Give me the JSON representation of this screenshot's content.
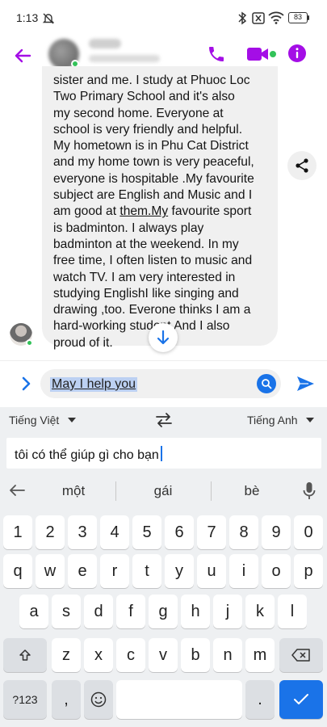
{
  "status_bar": {
    "time": "1:13",
    "battery": "83",
    "icons": [
      "mute-icon",
      "bluetooth-icon",
      "sim-icon",
      "wifi-icon",
      "battery-icon"
    ]
  },
  "header": {
    "back_icon": "back-arrow-icon",
    "actions": [
      "phone-icon",
      "video-icon",
      "info-icon"
    ]
  },
  "conversation": {
    "message_lines": [
      "sister and me. I study at Phuoc Loc",
      "Two Primary School and it's also",
      "my second home. Everyone at",
      "school is very friendly and helpful.",
      "My hometown is in Phu Cat District",
      "and my home town is very peaceful,",
      "everyone is hospitable .My favourite",
      "subject are English and Music and I"
    ],
    "line9_before": "am good at ",
    "line9_link": "them.My",
    "line9_after": " favourite sport",
    "message_lines_end": [
      "is badminton. I always play",
      "badminton at the weekend. In my",
      "free time, I often listen to music and",
      "watch TV. I am very interested in",
      "studying EnglishI like singing and",
      "drawing ,too. Everone thinks I am a",
      "hard-working student And I also",
      "proud of it."
    ]
  },
  "composer": {
    "text": "May I help you"
  },
  "translate": {
    "source_language": "Tiếng Việt",
    "target_language": "Tiếng Anh",
    "translated_text": "tôi có thể giúp gì cho bạn"
  },
  "suggestions": [
    "một",
    "gái",
    "bè"
  ],
  "keyboard": {
    "numbers": [
      "1",
      "2",
      "3",
      "4",
      "5",
      "6",
      "7",
      "8",
      "9",
      "0"
    ],
    "row1": [
      "q",
      "w",
      "e",
      "r",
      "t",
      "y",
      "u",
      "i",
      "o",
      "p"
    ],
    "row2": [
      "a",
      "s",
      "d",
      "f",
      "g",
      "h",
      "j",
      "k",
      "l"
    ],
    "row3": [
      "z",
      "x",
      "c",
      "v",
      "b",
      "n",
      "m"
    ],
    "symbols_label": "?123",
    "comma": ",",
    "period": "."
  },
  "colors": {
    "messenger_purple": "#a40ee6",
    "online_green": "#33c259",
    "keyboard_blue": "#1a73e8"
  }
}
